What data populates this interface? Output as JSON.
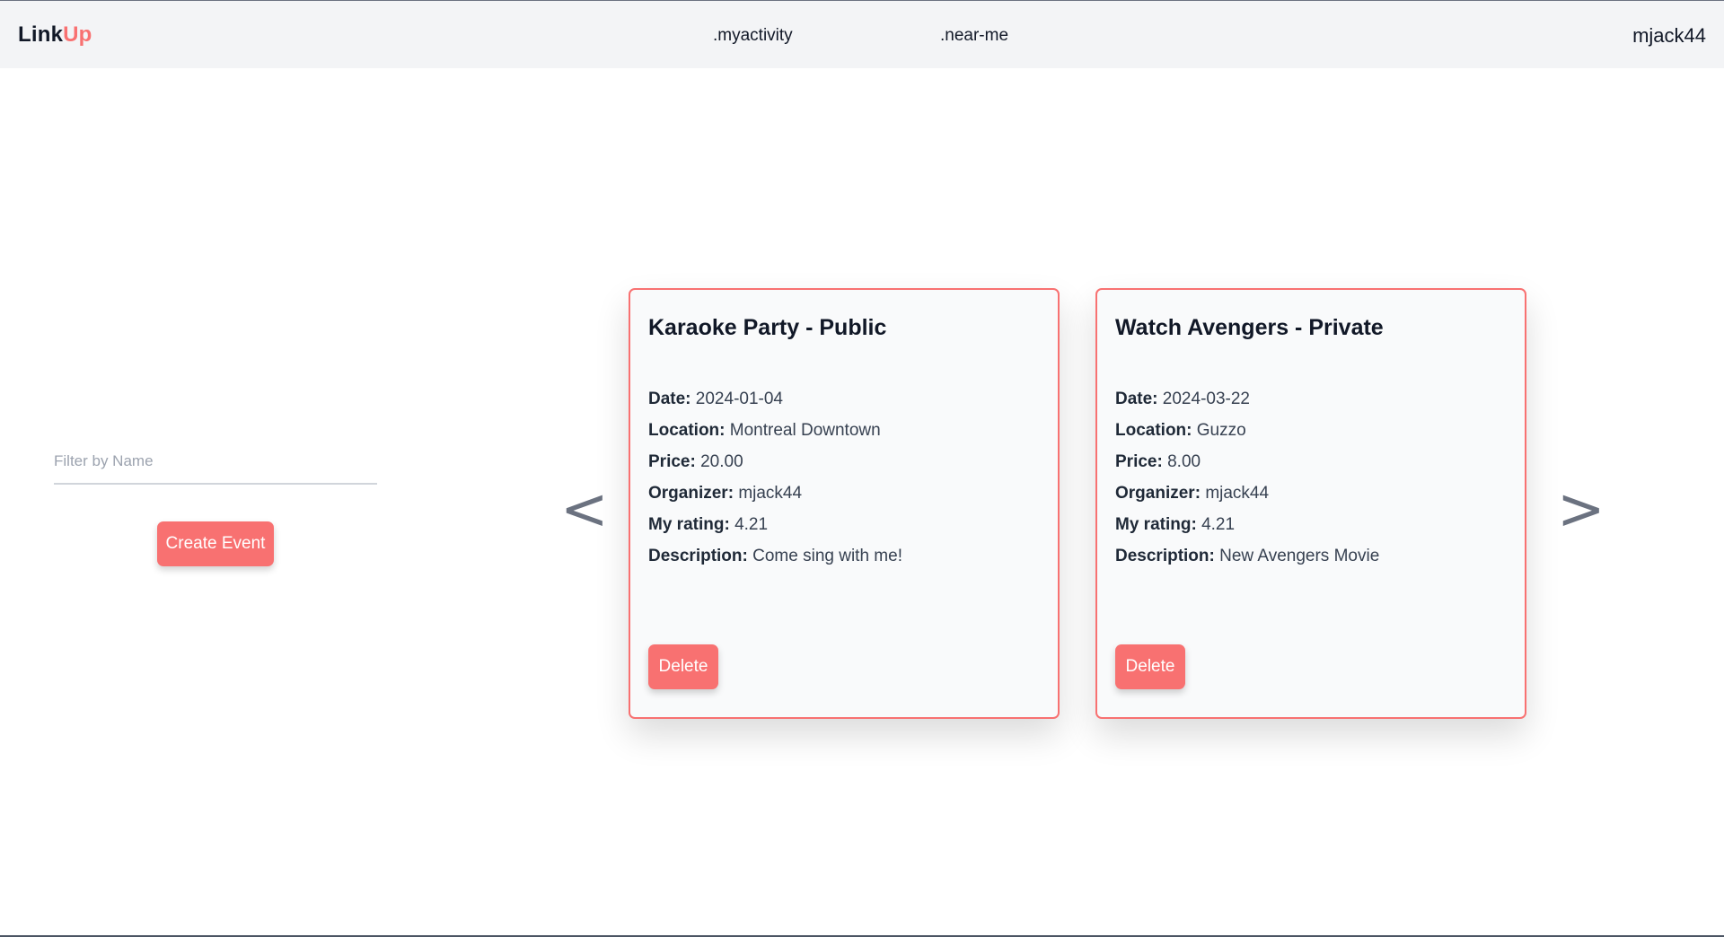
{
  "header": {
    "logo_part1": "Link",
    "logo_part2": "Up",
    "nav": [
      ".myactivity",
      ".near-me"
    ],
    "username": "mjack44"
  },
  "filter": {
    "placeholder": "Filter by Name",
    "value": ""
  },
  "create_button": "Create Event",
  "carousel": {
    "prev_label": "<",
    "next_label": ">"
  },
  "labels": {
    "date": "Date:",
    "location": "Location:",
    "price": "Price:",
    "organizer": "Organizer:",
    "rating": "My rating:",
    "description": "Description:",
    "delete": "Delete"
  },
  "events": [
    {
      "title": "Karaoke Party - Public",
      "date": "2024-01-04",
      "location": "Montreal Downtown",
      "price": "20.00",
      "organizer": "mjack44",
      "rating": "4.21",
      "description": "Come sing with me!"
    },
    {
      "title": "Watch Avengers - Private",
      "date": "2024-03-22",
      "location": "Guzzo",
      "price": "8.00",
      "organizer": "mjack44",
      "rating": "4.21",
      "description": "New Avengers Movie"
    }
  ],
  "colors": {
    "accent": "#f87171",
    "header_bg": "#f3f4f6",
    "card_bg": "#f9fafb"
  }
}
